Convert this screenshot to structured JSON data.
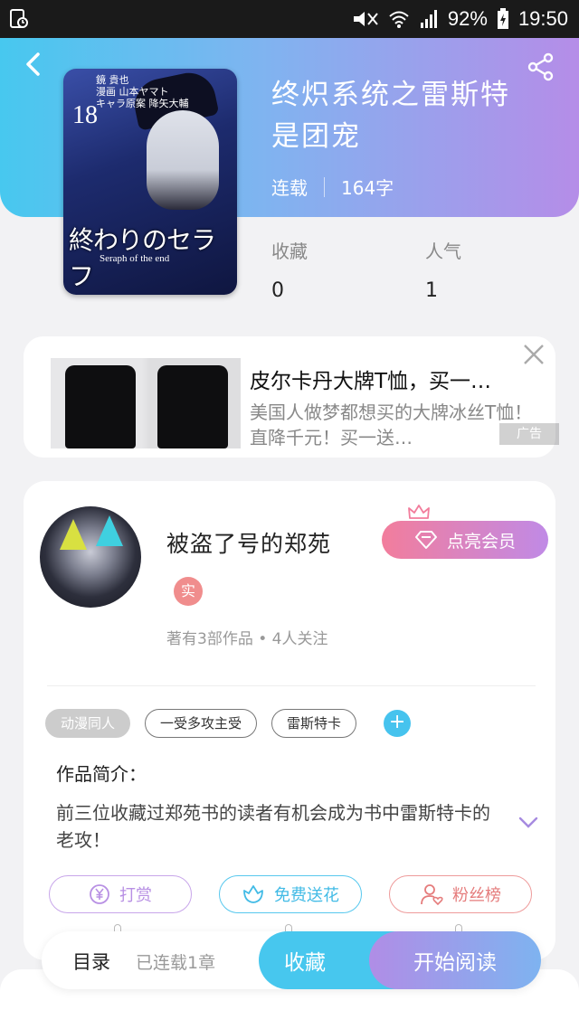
{
  "status_bar": {
    "battery": "92%",
    "time": "19:50"
  },
  "book": {
    "title": "终炽系统之雷斯特是团宠",
    "status": "连载",
    "word_count": "164字",
    "cover": {
      "volume": "18",
      "author_lines": [
        "鏡 貴也",
        "漫画 山本ヤマト",
        "キャラ原案 降矢大輔"
      ],
      "title_jp": "終わりのセラフ",
      "title_en": "Seraph of the end"
    }
  },
  "stats": {
    "favorites_label": "收藏",
    "favorites_value": "0",
    "popularity_label": "人气",
    "popularity_value": "1"
  },
  "ad": {
    "title": "皮尔卡丹大牌T恤，买一…",
    "description": "美国人做梦都想买的大牌冰丝T恤！直降千元！买一送…",
    "badge": "广告"
  },
  "author": {
    "name": "被盗了号的郑苑",
    "vip_button": "点亮会员",
    "real_badge": "实",
    "works_info": "著有3部作品 • 4人关注"
  },
  "tags": [
    "动漫同人",
    "一受多攻主受",
    "雷斯特卡"
  ],
  "intro": {
    "label": "作品简介：",
    "text": "前三位收藏过郑苑书的读者有机会成为书中雷斯特卡的老攻！"
  },
  "actions": {
    "reward": "打赏",
    "flower": "免费送花",
    "fans": "粉丝榜"
  },
  "bottom_bar": {
    "toc": "目录",
    "toc_status": "已连载1章",
    "favorite": "收藏",
    "start_reading": "开始阅读"
  },
  "colors": {
    "header_start": "#47c8ef",
    "header_end": "#b58de8",
    "accent_blue": "#47c7ee",
    "vip_pink": "#f27d9c",
    "vip_purple": "#c08ae6"
  }
}
